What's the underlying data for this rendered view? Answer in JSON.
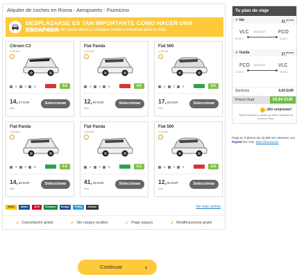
{
  "main": {
    "title": "Alquiler de coches en Roma - Aeropuerto - Fiumicino",
    "promo": {
      "title": "DESPLAZARSE ES TAN IMPORTANTE COMO HACER UNA ESCAPADA",
      "subtitle": "Reserva tu alquiler de coche ahora y consigue tarifas exclusivas para tu viaje.",
      "icon": "car-icon"
    },
    "cars": [
      {
        "name": "Citroen C3",
        "similar": "o similar",
        "seats": "5",
        "bags": "2",
        "doors": "5",
        "brand": "Hertz-style",
        "brand_color": "#d33",
        "rating": "6.6",
        "price": "14,",
        "price_dec": "07 EUR",
        "per_day": "/día",
        "button": "Seleccionar"
      },
      {
        "name": "Fiat Panda",
        "similar": "o similar",
        "seats": "4",
        "bags": "2",
        "doors": "5",
        "brand": "Hertz-style",
        "brand_color": "#d33",
        "rating": "6.6",
        "price": "12,",
        "price_dec": "80 EUR",
        "per_day": "/día",
        "button": "Seleccionar"
      },
      {
        "name": "Fiat 500",
        "similar": "o similar",
        "seats": "4",
        "bags": "2",
        "doors": "3",
        "brand": "green",
        "brand_color": "#2ea44f",
        "rating": "6.6",
        "price": "17,",
        "price_dec": "63 EUR",
        "per_day": "/día",
        "button": "Seleccionar"
      },
      {
        "name": "Fiat Panda",
        "similar": "o similar",
        "seats": "4",
        "bags": "2",
        "doors": "5",
        "brand": "green",
        "brand_color": "#2ea44f",
        "rating": "6.6",
        "price": "14,",
        "price_dec": "65 EUR",
        "per_day": "/día",
        "button": "Seleccionar"
      },
      {
        "name": "Fiat Panda",
        "similar": "o similar",
        "seats": "4",
        "bags": "2",
        "doors": "5",
        "brand": "green",
        "brand_color": "#2ea44f",
        "rating": "6.3",
        "price": "41,",
        "price_dec": "56 EUR",
        "per_day": "/día",
        "button": "Seleccionar"
      },
      {
        "name": "Fiat 500",
        "similar": "o similar",
        "seats": "4",
        "bags": "2",
        "doors": "3",
        "brand": "Hertz-style",
        "brand_color": "#d33",
        "rating": "6.6",
        "price": "12,",
        "price_dec": "60 EUR",
        "per_day": "/día",
        "button": "Seleccionar"
      }
    ],
    "providers": [
      {
        "label": "Hertz",
        "color": "#f5c400",
        "text_color": "#222"
      },
      {
        "label": "Alamo",
        "color": "#1b4fa0",
        "text_color": "#fff"
      },
      {
        "label": "AVIS",
        "color": "#d4002a",
        "text_color": "#fff"
      },
      {
        "label": "Europcar",
        "color": "#0a8a3a",
        "text_color": "#fff"
      },
      {
        "label": "Budget",
        "color": "#1a4c8c",
        "text_color": "#fff"
      },
      {
        "label": "Thrifty",
        "color": "#2aa0d8",
        "text_color": "#fff"
      },
      {
        "label": "Goldcar",
        "color": "#333333",
        "text_color": "#fff"
      }
    ],
    "more_link": "Ver más coches",
    "features": [
      "Cancelación gratis",
      "Sin cargos ocultos",
      "Pago seguro",
      "Modificaciones gratis"
    ]
  },
  "sidebar": {
    "title": "Tu plan de viaje",
    "outbound": {
      "label": "Ida",
      "price": "31,",
      "price_sup": "96 EUR",
      "from": "VLC",
      "to": "FCO",
      "date": "09/11/2023",
      "dep": "09:40 h",
      "arr": "11:40 h"
    },
    "return": {
      "label": "Vuelta",
      "price": "27,",
      "price_sup": "96 EUR",
      "from": "FCO",
      "to": "VLC",
      "date": "16/11/2023",
      "dep": "07:00 h",
      "arr": "09:05 h"
    },
    "services": {
      "label": "Servicios",
      "value": "0,00 EUR"
    },
    "final": {
      "label": "Precio final",
      "value": "59,94 EUR"
    },
    "surprise_title": "¡Sin sorpresas!",
    "surprise_text": "Todas las tasas y cuotas ya están incluidas en el precio final."
  },
  "payment": {
    "text": "Paga en 3 plazos de 19,99€ sin intereses con",
    "brand": "PayPal",
    "tae": "0% TAE",
    "link": "Más información"
  },
  "continue": {
    "label": "Continuar",
    "arrow": "›"
  },
  "colors": {
    "accent": "#ffc93c",
    "rating": "#7ec247",
    "final": "#6cbf3f",
    "sidebar_head": "#4d4d4d"
  }
}
